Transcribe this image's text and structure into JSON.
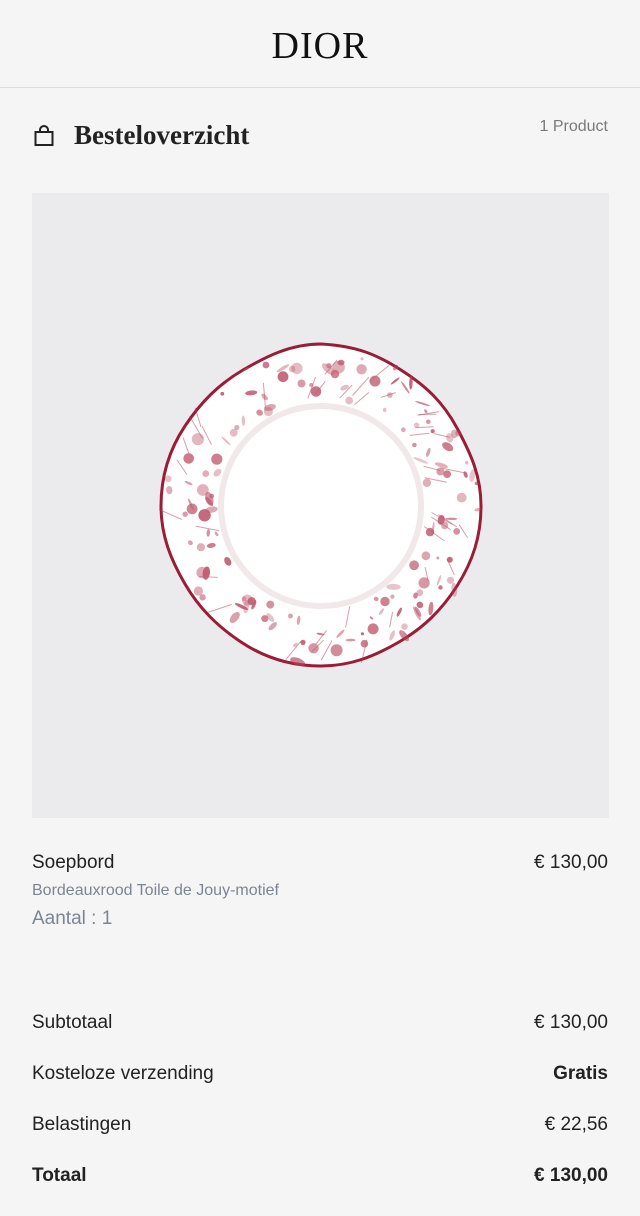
{
  "brand": "DIOR",
  "summary": {
    "title": "Besteloverzicht",
    "count": "1 Product",
    "icon": "shopping-bag-icon"
  },
  "item": {
    "image": "soup-plate-red-toile-de-jouy",
    "name": "Soepbord",
    "variant": "Bordeauxrood Toile de Jouy-motief",
    "quantity": "Aantal : 1",
    "price": "€ 130,00"
  },
  "totals": {
    "subtotal_label": "Subtotaal",
    "subtotal_value": "€ 130,00",
    "shipping_label": "Kosteloze verzending",
    "shipping_value": "Gratis",
    "tax_label": "Belastingen",
    "tax_value": "€ 22,56",
    "total_label": "Totaal",
    "total_value": "€ 130,00"
  },
  "colors": {
    "background": "#f5f5f5",
    "image_panel": "#ebebee",
    "plate_pattern": "#a3304a",
    "muted_text": "#7b8594"
  }
}
